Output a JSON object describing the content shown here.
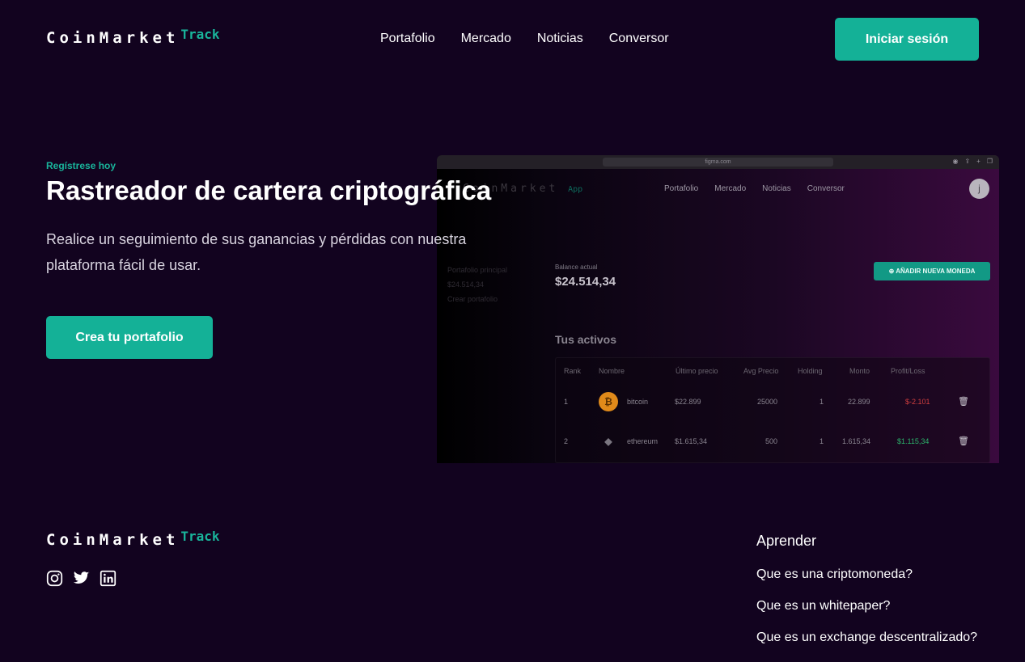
{
  "brand": {
    "name": "CoinMarket",
    "suffix": "Track"
  },
  "nav": {
    "items": [
      "Portafolio",
      "Mercado",
      "Noticias",
      "Conversor"
    ],
    "login": "Iniciar sesión"
  },
  "hero": {
    "eyebrow": "Regístrese hoy",
    "title": "Rastreador de cartera criptográfica",
    "lead": "Realice un seguimiento de sus ganancias y pérdidas con nuestra plataforma fácil de usar.",
    "cta": "Crea tu portafolio"
  },
  "preview": {
    "url": "figma.com",
    "brand": "CoinMarket",
    "brand_suffix": "App",
    "nav": [
      "Portafolio",
      "Mercado",
      "Noticias",
      "Conversor"
    ],
    "avatar": "j",
    "side": [
      "Portafolio principal",
      "$24.514,34",
      "Crear portafolio"
    ],
    "balance_label": "Balance actual",
    "balance": "$24.514,34",
    "add_button": "AÑADIR NUEVA MONEDA",
    "assets_title": "Tus activos",
    "columns": [
      "Rank",
      "Nombre",
      "Último precio",
      "Avg Precio",
      "Holding",
      "Monto",
      "Profit/Loss"
    ],
    "rows": [
      {
        "rank": "1",
        "name": "bitcoin",
        "price": "$22.899",
        "avg": "25000",
        "holding": "1",
        "amount": "22.899",
        "pl": "$-2.101",
        "pl_sign": "neg"
      },
      {
        "rank": "2",
        "name": "ethereum",
        "price": "$1.615,34",
        "avg": "500",
        "holding": "1",
        "amount": "1.615,34",
        "pl": "$1.115,34",
        "pl_sign": "pos"
      }
    ]
  },
  "footer": {
    "brand": "CoinMarket",
    "suffix": "Track",
    "learn_title": "Aprender",
    "links": [
      "Que es una criptomoneda?",
      "Que es un whitepaper?",
      "Que es un exchange descentralizado?"
    ]
  },
  "colors": {
    "accent": "#14b197",
    "background": "#12031f"
  }
}
